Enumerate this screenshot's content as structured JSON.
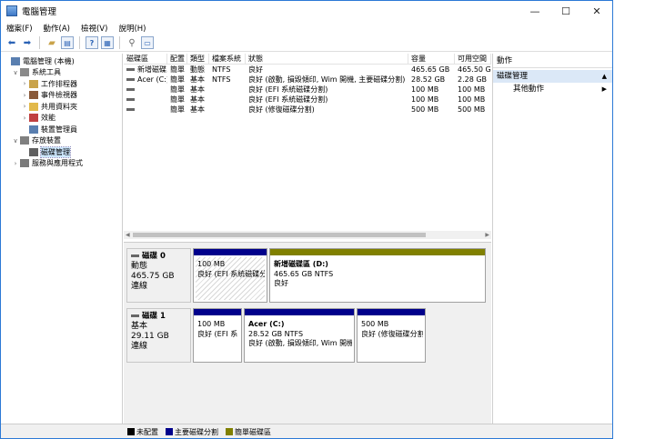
{
  "window": {
    "title": "電腦管理",
    "min": "—",
    "max": "☐",
    "close": "✕"
  },
  "menu": [
    "檔案(F)",
    "動作(A)",
    "檢視(V)",
    "說明(H)"
  ],
  "tree": [
    {
      "label": "電腦管理 (本機)",
      "indent": 0,
      "arrow": "",
      "icon": "computer-icon",
      "color": "#5a7fb0"
    },
    {
      "label": "系統工具",
      "indent": 1,
      "arrow": "∨",
      "icon": "tools-icon",
      "color": "#8a8a8a"
    },
    {
      "label": "工作排程器",
      "indent": 2,
      "arrow": "›",
      "icon": "clock-icon",
      "color": "#c9a34a"
    },
    {
      "label": "事件檢視器",
      "indent": 2,
      "arrow": "›",
      "icon": "event-viewer-icon",
      "color": "#8a5a3a"
    },
    {
      "label": "共用資料夾",
      "indent": 2,
      "arrow": "›",
      "icon": "shared-folder-icon",
      "color": "#e2b94a"
    },
    {
      "label": "效能",
      "indent": 2,
      "arrow": "›",
      "icon": "performance-icon",
      "color": "#c04040"
    },
    {
      "label": "裝置管理員",
      "indent": 2,
      "arrow": "",
      "icon": "device-manager-icon",
      "color": "#5a7fb0"
    },
    {
      "label": "存放裝置",
      "indent": 1,
      "arrow": "∨",
      "icon": "storage-icon",
      "color": "#808080"
    },
    {
      "label": "磁碟管理",
      "indent": 2,
      "arrow": "",
      "icon": "disk-management-icon",
      "color": "#606060",
      "selected": true
    },
    {
      "label": "服務與應用程式",
      "indent": 1,
      "arrow": "›",
      "icon": "services-icon",
      "color": "#7a7a7a"
    }
  ],
  "table": {
    "headers": [
      "磁碟區",
      "配置",
      "類型",
      "檔案系統",
      "狀態",
      "容量",
      "可用空間"
    ],
    "rows": [
      [
        "新增磁碟...",
        "簡單",
        "動態",
        "NTFS",
        "良好",
        "465.65 GB",
        "465.50 G"
      ],
      [
        "Acer (C:)",
        "簡單",
        "基本",
        "NTFS",
        "良好 (啟動, 損毀傾印, Wim 開機, 主要磁碟分割)",
        "28.52 GB",
        "2.28 GB"
      ],
      [
        "",
        "簡單",
        "基本",
        "",
        "良好 (EFI 系統磁碟分割)",
        "100 MB",
        "100 MB"
      ],
      [
        "",
        "簡單",
        "基本",
        "",
        "良好 (EFI 系統磁碟分割)",
        "100 MB",
        "100 MB"
      ],
      [
        "",
        "簡單",
        "基本",
        "",
        "良好 (修復磁碟分割)",
        "500 MB",
        "500 MB"
      ]
    ]
  },
  "disks": [
    {
      "name": "磁碟 0",
      "type": "動態",
      "size": "465.75 GB",
      "status": "連線",
      "partitions": [
        {
          "name": "",
          "size": "100 MB",
          "status": "良好 (EFI 系統磁碟分",
          "color": "#00008b",
          "hatched": true
        },
        {
          "name": "新增磁碟區  (D:)",
          "size": "465.65 GB NTFS",
          "status": "良好",
          "color": "#808000",
          "hatched": false
        }
      ]
    },
    {
      "name": "磁碟 1",
      "type": "基本",
      "size": "29.11 GB",
      "status": "連線",
      "partitions": [
        {
          "name": "",
          "size": "100 MB",
          "status": "良好 (EFI 系",
          "color": "#00008b",
          "hatched": false
        },
        {
          "name": "Acer  (C:)",
          "size": "28.52 GB NTFS",
          "status": "良好 (啟動, 損毀傾印, Wim 開機",
          "color": "#00008b",
          "hatched": false
        },
        {
          "name": "",
          "size": "500 MB",
          "status": "良好 (修復磁碟分割",
          "color": "#00008b",
          "hatched": false
        }
      ]
    }
  ],
  "legend": [
    {
      "label": "未配置",
      "color": "#000000"
    },
    {
      "label": "主要磁碟分割",
      "color": "#00008b"
    },
    {
      "label": "簡單磁碟區",
      "color": "#808000"
    }
  ],
  "actions": {
    "header": "動作",
    "section": "磁碟管理",
    "more": "其他動作"
  }
}
